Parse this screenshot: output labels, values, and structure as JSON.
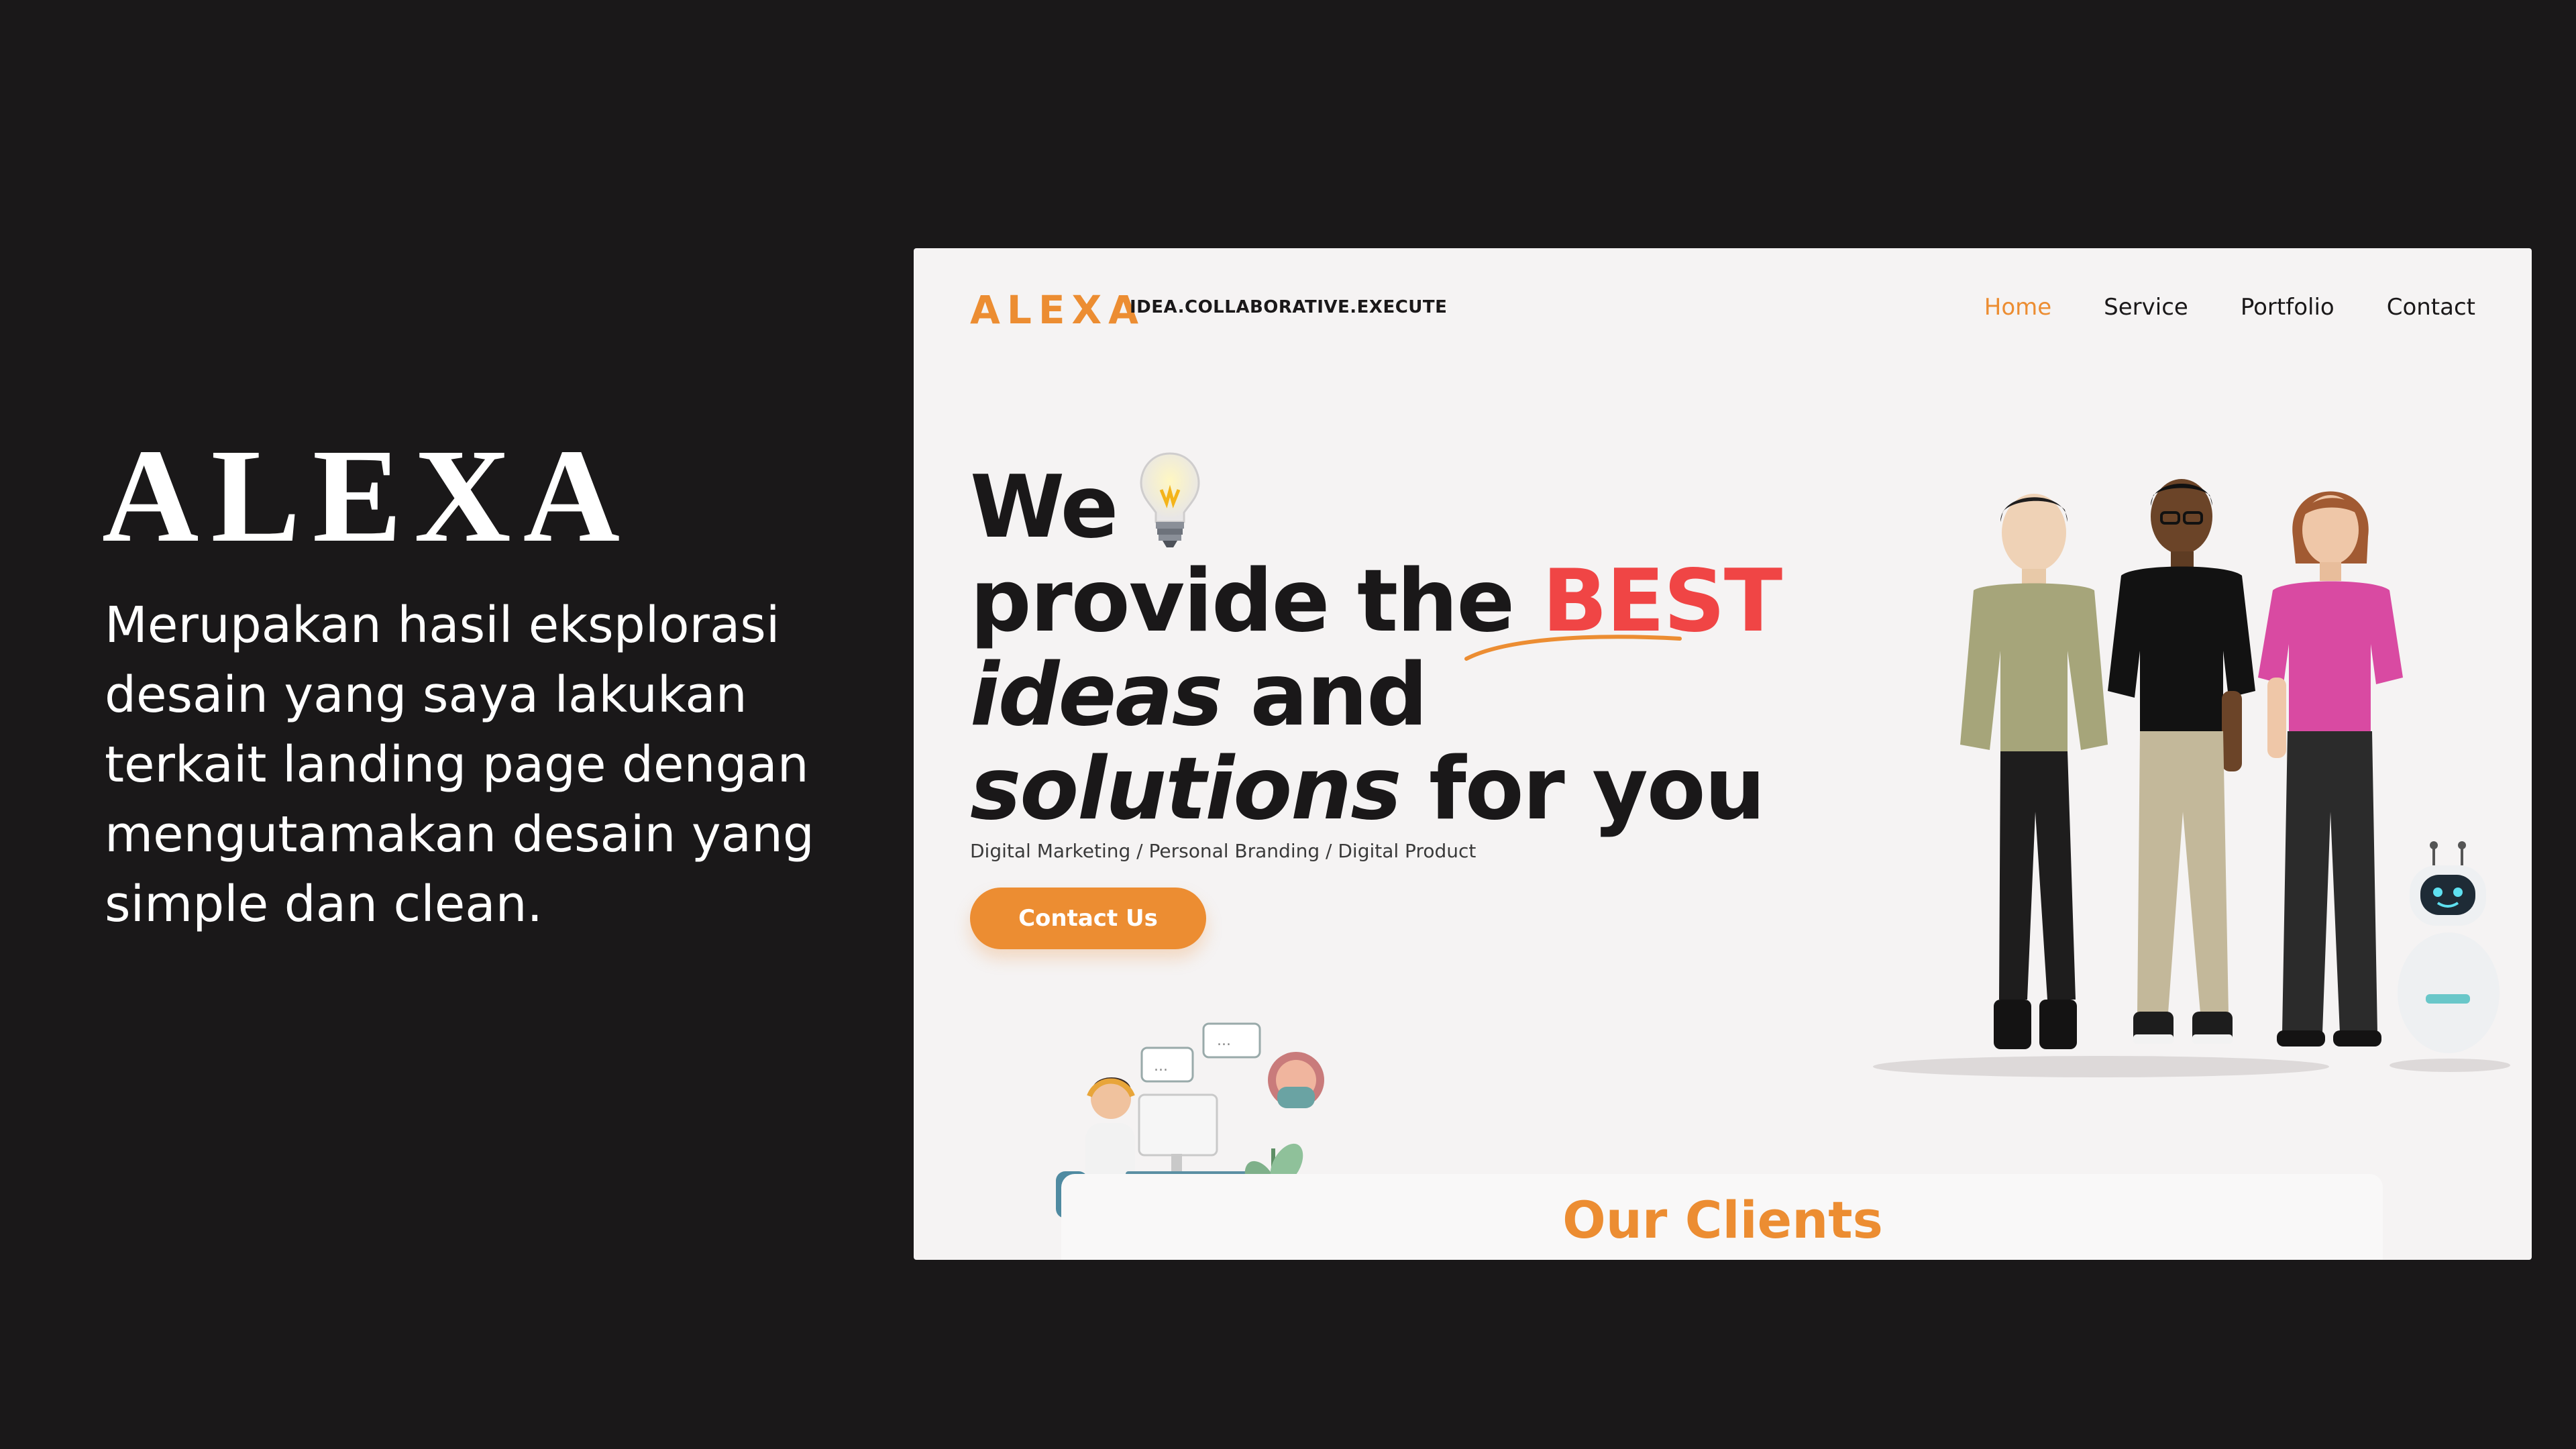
{
  "intro": {
    "brand": "ALEXA",
    "description": "Merupakan hasil eksplorasi desain yang saya lakukan terkait landing page dengan mengutamakan desain yang simple dan clean."
  },
  "site": {
    "logo": "ALEXA",
    "tagline": "IDEA.COLLABORATIVE.EXECUTE",
    "nav": [
      {
        "label": "Home",
        "active": true
      },
      {
        "label": "Service",
        "active": false
      },
      {
        "label": "Portfolio",
        "active": false
      },
      {
        "label": "Contact",
        "active": false
      }
    ],
    "hero": {
      "line1": "We",
      "line2_pre": "provide the ",
      "line2_highlight": "BEST",
      "line3_italic": "ideas",
      "line3_rest": " and",
      "line4_italic": "solutions",
      "line4_rest": " for you",
      "subtitle": "Digital Marketing / Personal Branding / Digital Product",
      "cta": "Contact Us"
    },
    "clients_title": "Our Clients"
  },
  "colors": {
    "accent": "#ec8d32",
    "highlight": "#f04545",
    "background": "#1a1819",
    "page": "#f5f3f3"
  }
}
